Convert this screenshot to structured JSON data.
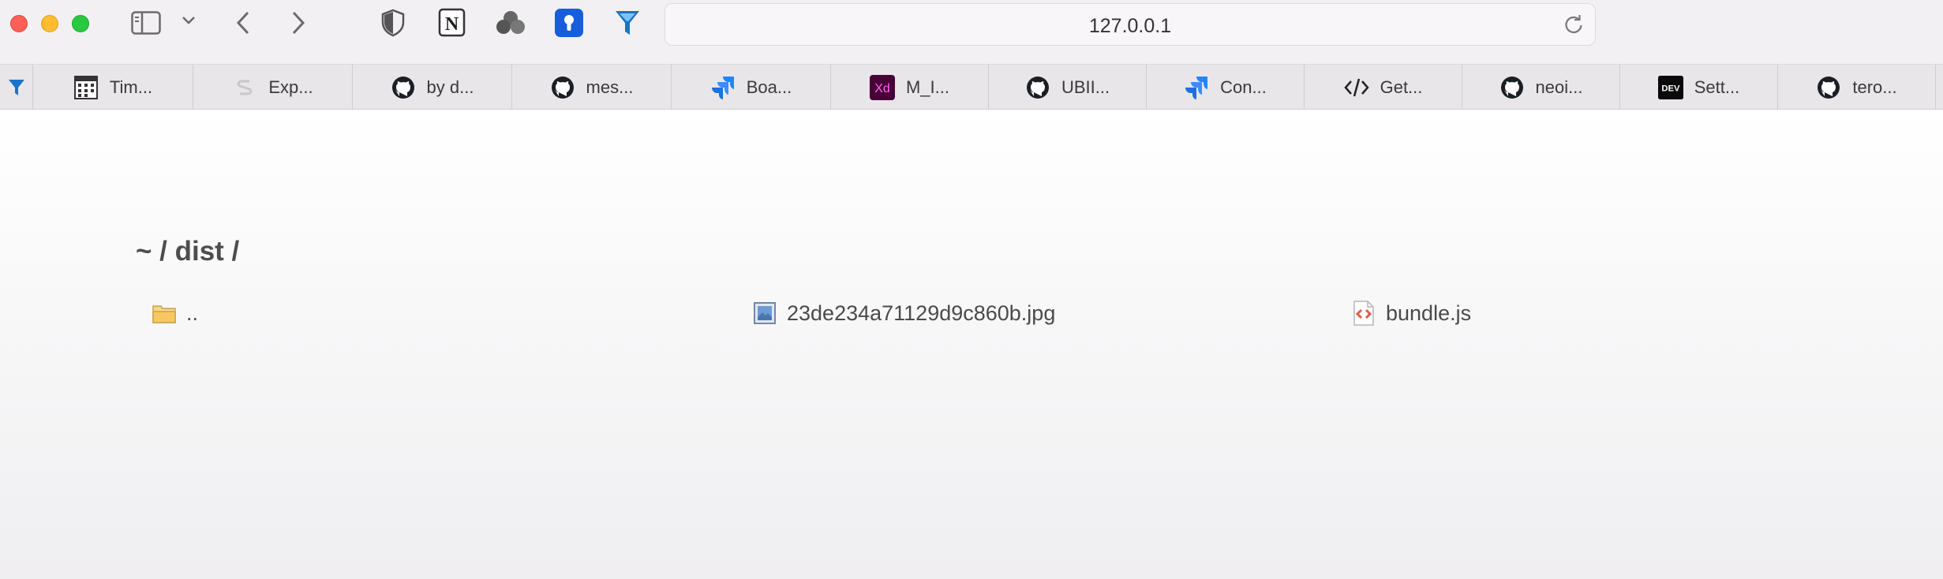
{
  "browser": {
    "url": "127.0.0.1",
    "icons": [
      "sidebar-icon",
      "chevron-down-icon",
      "back-icon",
      "forward-icon",
      "shield-icon",
      "notion-icon",
      "clover-icon",
      "password-keyhole-icon",
      "funnel-icon",
      "reload-icon"
    ]
  },
  "tabs": [
    {
      "icon": "funnel-icon",
      "label": ""
    },
    {
      "icon": "calendar-grid-icon",
      "label": "Tim..."
    },
    {
      "icon": "sync-icon",
      "label": "Exp..."
    },
    {
      "icon": "github-icon",
      "label": "by d..."
    },
    {
      "icon": "github-icon",
      "label": "mes..."
    },
    {
      "icon": "jira-icon",
      "label": "Boa..."
    },
    {
      "icon": "adobe-xd-icon",
      "label": "M_I...",
      "badge": "Xd"
    },
    {
      "icon": "github-icon",
      "label": "UBII..."
    },
    {
      "icon": "jira-icon",
      "label": "Con..."
    },
    {
      "icon": "code-icon",
      "label": "Get..."
    },
    {
      "icon": "github-icon",
      "label": "neoi..."
    },
    {
      "icon": "dev-icon",
      "label": "Sett...",
      "badge": "DEV"
    },
    {
      "icon": "github-icon",
      "label": "tero..."
    }
  ],
  "page": {
    "breadcrumb": "~ / dist /",
    "files": [
      {
        "name": "..",
        "icon": "folder-icon"
      },
      {
        "name": "23de234a71129d9c860b.jpg",
        "icon": "image-file-icon"
      },
      {
        "name": "bundle.js",
        "icon": "script-file-icon"
      }
    ]
  },
  "colors": {
    "close": "#fe5f57",
    "minimize": "#febc2e",
    "maximize": "#28c840",
    "bitwarden": "#175ddc",
    "jira": "#2684ff",
    "xd": "#470137",
    "folder": "#f2c46d"
  }
}
